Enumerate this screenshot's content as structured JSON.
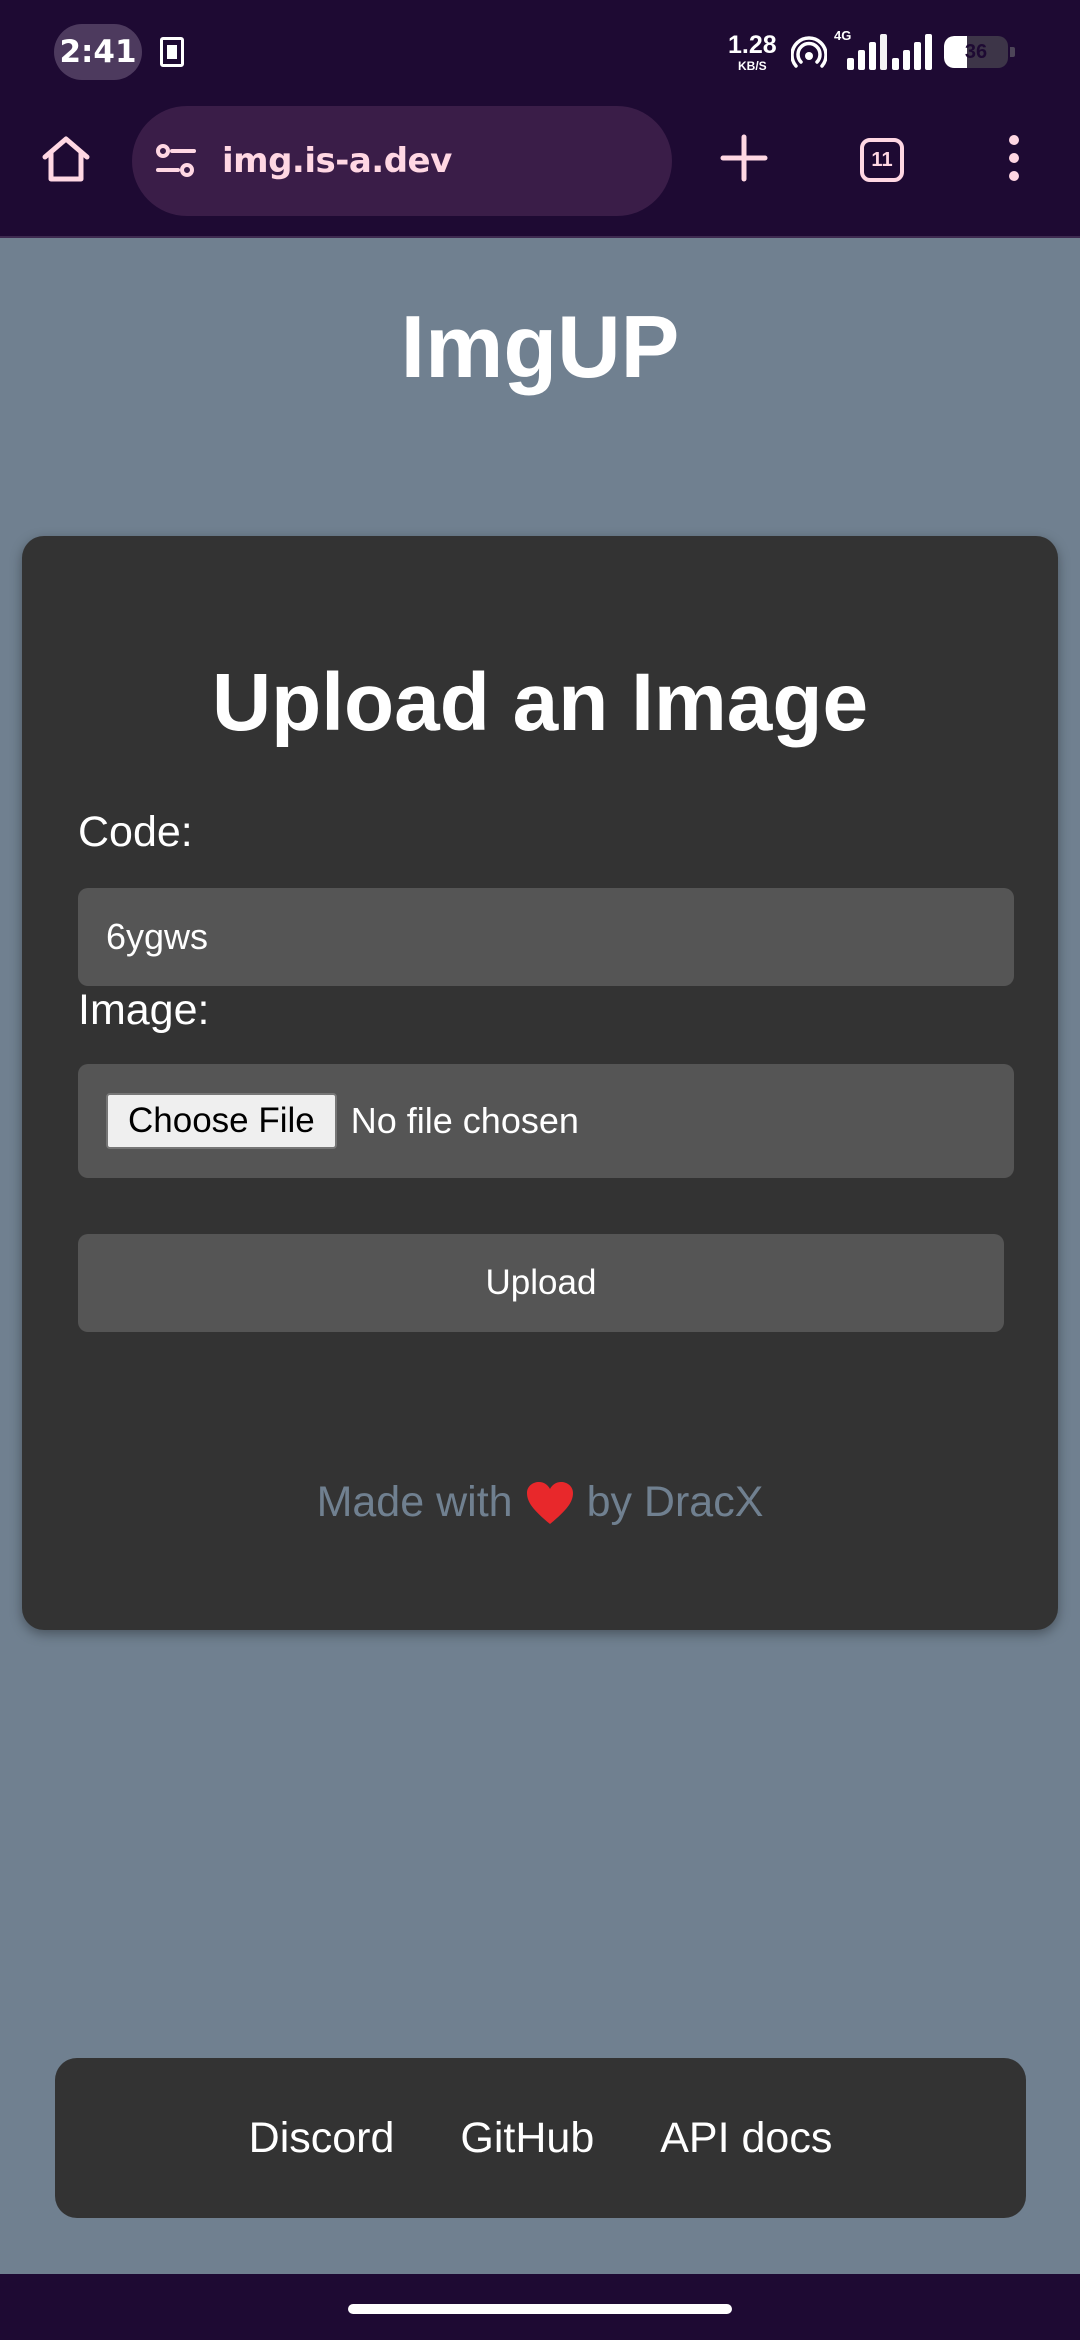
{
  "status_bar": {
    "time": "2:41",
    "net_speed_value": "1.28",
    "net_speed_unit": "KB/S",
    "network_type": "4G",
    "battery_level": "36",
    "battery_percent": 36,
    "icons": [
      "notification-icon",
      "hotspot-icon",
      "signal-icon",
      "battery-icon"
    ]
  },
  "browser": {
    "url": "img.is-a.dev",
    "tab_count": "11",
    "accent_color": "#ffd7e3",
    "bar_color": "#1e0a33",
    "icons": [
      "home-icon",
      "site-settings-icon",
      "new-tab-icon",
      "tab-switcher-icon",
      "more-menu-icon"
    ]
  },
  "page": {
    "site_title": "ImgUP",
    "background_color": "#708090",
    "card": {
      "title": "Upload an Image",
      "code_label": "Code:",
      "code_value": "6ygws",
      "image_label": "Image:",
      "choose_file_label": "Choose File",
      "no_file_text": "No file chosen",
      "upload_label": "Upload",
      "credit_prefix": "Made with",
      "credit_heart": "❤️",
      "credit_suffix": "by DracX"
    },
    "footer_links": [
      "Discord",
      "GitHub",
      "API docs"
    ]
  }
}
